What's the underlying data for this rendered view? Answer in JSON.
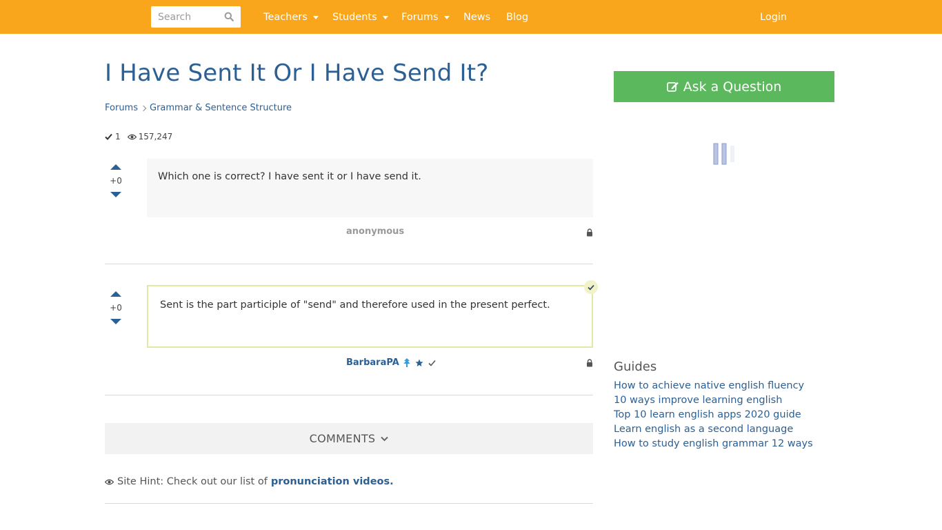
{
  "header": {
    "search_placeholder": "Search",
    "nav": {
      "teachers": "Teachers",
      "students": "Students",
      "forums": "Forums",
      "news": "News",
      "blog": "Blog"
    },
    "login": "Login"
  },
  "question": {
    "title": "I Have Sent It Or I Have Send It?",
    "breadcrumb": [
      "Forums",
      "Grammar & Sentence Structure"
    ],
    "answers_count": "1",
    "views": "157,247",
    "body": "Which one is correct? I have sent it or I have send it.",
    "votes": "+0",
    "author": "anonymous"
  },
  "answer": {
    "body": "Sent is the part participle of \"send\" and therefore used in the present perfect.",
    "votes": "+0",
    "author": "BarbaraPA"
  },
  "comments_label": "COMMENTS",
  "hint": {
    "text": "Site Hint: Check out our list of",
    "link": "pronunciation videos."
  },
  "sidebar": {
    "ask_button": "Ask a Question",
    "guides_title": "Guides",
    "guides": [
      "How to achieve native english fluency",
      "10 ways improve learning english",
      "Top 10 learn english apps 2020 guide",
      "Learn english as a second language",
      "How to study english grammar 12 ways"
    ]
  },
  "colors": {
    "topbar": "#f9a61d",
    "link": "#2c5f93",
    "ask_button": "#5cb85c",
    "accepted_border": "#dfe9a3"
  }
}
